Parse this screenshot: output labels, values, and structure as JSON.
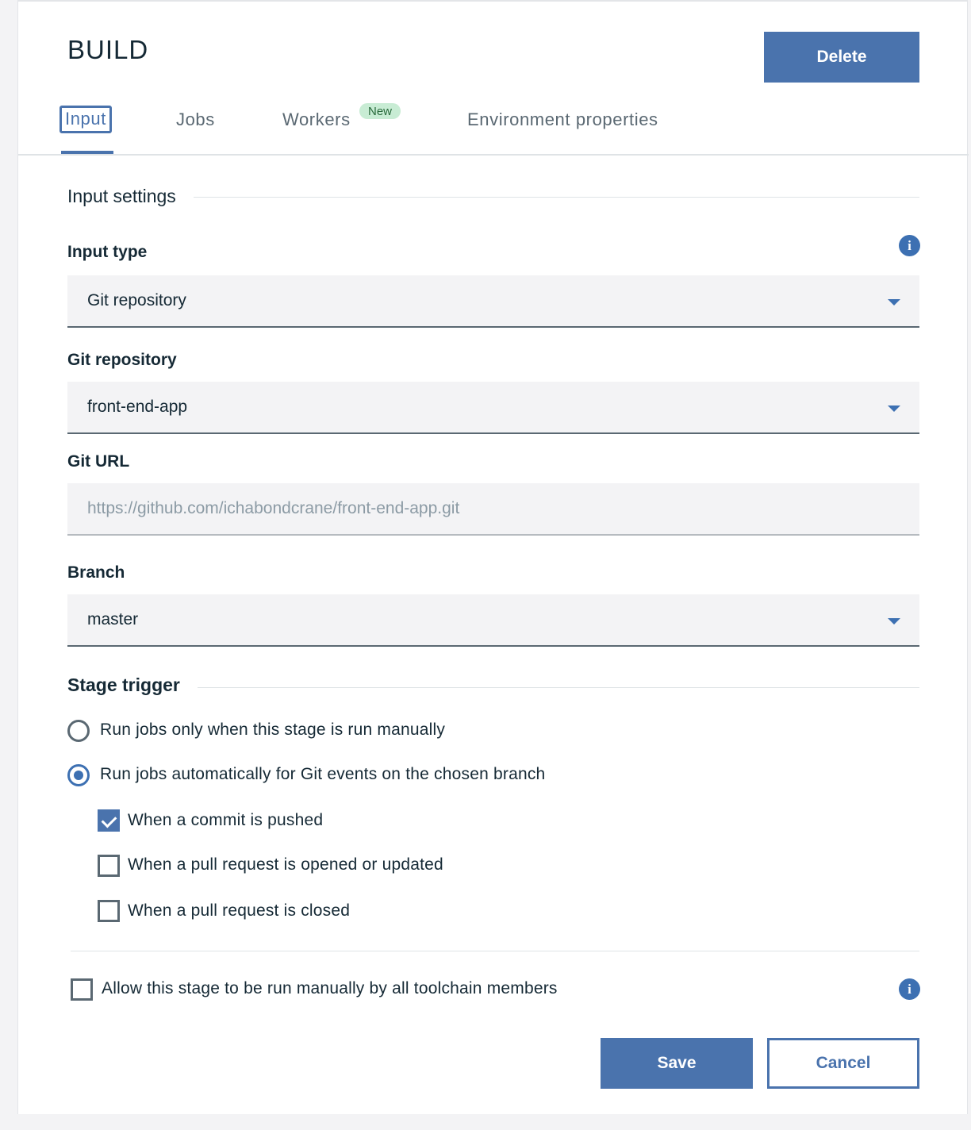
{
  "header": {
    "title": "BUILD",
    "delete_label": "Delete"
  },
  "tabs": [
    {
      "label": "Input",
      "active": true
    },
    {
      "label": "Jobs",
      "active": false
    },
    {
      "label": "Workers",
      "active": false,
      "badge": "New"
    },
    {
      "label": "Environment properties",
      "active": false
    }
  ],
  "input_settings": {
    "section_title": "Input settings",
    "input_type": {
      "label": "Input type",
      "value": "Git repository"
    },
    "git_repository": {
      "label": "Git repository",
      "value": "front-end-app"
    },
    "git_url": {
      "label": "Git URL",
      "value": "https://github.com/ichabondcrane/front-end-app.git"
    },
    "branch": {
      "label": "Branch",
      "value": "master"
    }
  },
  "stage_trigger": {
    "section_title": "Stage trigger",
    "options": [
      {
        "label": "Run jobs only when this stage is run manually",
        "selected": false
      },
      {
        "label": "Run jobs automatically for Git events on the chosen branch",
        "selected": true
      }
    ],
    "events": [
      {
        "label": "When a commit is pushed",
        "checked": true
      },
      {
        "label": "When a pull request is opened or updated",
        "checked": false
      },
      {
        "label": "When a pull request is closed",
        "checked": false
      }
    ]
  },
  "allow_manual": {
    "label": "Allow this stage to be run manually by all toolchain members",
    "checked": false
  },
  "footer": {
    "save_label": "Save",
    "cancel_label": "Cancel"
  },
  "colors": {
    "accent": "#4a73ad",
    "badge_bg": "#c8ecd4"
  },
  "icons": {
    "info": "info-icon",
    "dropdown": "chevron-down-icon",
    "check": "checkmark-icon"
  }
}
